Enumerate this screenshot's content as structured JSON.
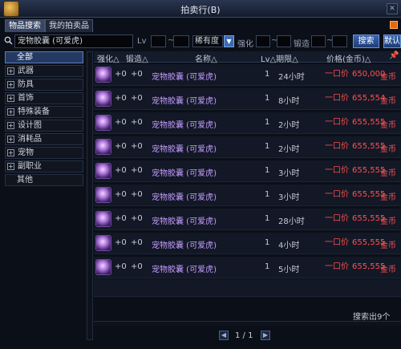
{
  "window": {
    "title": "拍卖行(B)"
  },
  "tabs": [
    {
      "label": "物品搜索"
    },
    {
      "label": "我的拍卖品"
    }
  ],
  "search": {
    "keyword": "宠物胶囊 (可爱虎)",
    "lv_label": "Lv",
    "rarity_value": "稀有度",
    "strength_label": "强化",
    "forge_label": "锻造",
    "tilde": "~",
    "search_button": "搜索",
    "default_button": "默认"
  },
  "categories": [
    {
      "label": "全部",
      "has_expand": false
    },
    {
      "label": "武器",
      "has_expand": true
    },
    {
      "label": "防具",
      "has_expand": true
    },
    {
      "label": "首饰",
      "has_expand": true
    },
    {
      "label": "特殊装备",
      "has_expand": true
    },
    {
      "label": "设计图",
      "has_expand": true
    },
    {
      "label": "消耗品",
      "has_expand": true
    },
    {
      "label": "宠物",
      "has_expand": true
    },
    {
      "label": "副职业",
      "has_expand": true
    },
    {
      "label": "其他",
      "has_expand": false
    }
  ],
  "table": {
    "headers": {
      "strength": "强化△",
      "forge": "锻造△",
      "name": "名称△",
      "lv_time": "Lv△期限△",
      "price": "价格(金币)△"
    },
    "rows": [
      {
        "strength": "+0",
        "forge": "+0",
        "name": "宠物胶囊 (可爱虎)",
        "lv": "1",
        "time": "24小时",
        "buy": "一口价",
        "price": "650,000",
        "unit": "金币"
      },
      {
        "strength": "+0",
        "forge": "+0",
        "name": "宠物胶囊 (可爱虎)",
        "lv": "1",
        "time": "8小时",
        "buy": "一口价",
        "price": "655,554",
        "unit": "金币"
      },
      {
        "strength": "+0",
        "forge": "+0",
        "name": "宠物胶囊 (可爱虎)",
        "lv": "1",
        "time": "2小时",
        "buy": "一口价",
        "price": "655,555",
        "unit": "金币"
      },
      {
        "strength": "+0",
        "forge": "+0",
        "name": "宠物胶囊 (可爱虎)",
        "lv": "1",
        "time": "2小时",
        "buy": "一口价",
        "price": "655,555",
        "unit": "金币"
      },
      {
        "strength": "+0",
        "forge": "+0",
        "name": "宠物胶囊 (可爱虎)",
        "lv": "1",
        "time": "3小时",
        "buy": "一口价",
        "price": "655,555",
        "unit": "金币"
      },
      {
        "strength": "+0",
        "forge": "+0",
        "name": "宠物胶囊 (可爱虎)",
        "lv": "1",
        "time": "3小时",
        "buy": "一口价",
        "price": "655,555",
        "unit": "金币"
      },
      {
        "strength": "+0",
        "forge": "+0",
        "name": "宠物胶囊 (可爱虎)",
        "lv": "1",
        "time": "28小时",
        "buy": "一口价",
        "price": "655,555",
        "unit": "金币"
      },
      {
        "strength": "+0",
        "forge": "+0",
        "name": "宠物胶囊 (可爱虎)",
        "lv": "1",
        "time": "4小时",
        "buy": "一口价",
        "price": "655,555",
        "unit": "金币"
      },
      {
        "strength": "+0",
        "forge": "+0",
        "name": "宠物胶囊 (可爱虎)",
        "lv": "1",
        "time": "5小时",
        "buy": "一口价",
        "price": "655,555",
        "unit": "金币"
      }
    ]
  },
  "pagination": {
    "page_text": "1 / 1"
  },
  "result_count": "搜索出9个",
  "icons": {
    "search": "search-icon",
    "item": "pet-capsule-icon",
    "prev": "arrow-left-icon",
    "next": "arrow-right-icon",
    "pin": "pin-icon",
    "dropdown": "chevron-down-icon"
  },
  "colors": {
    "price": "#ff5050",
    "item_name": "#c59cff",
    "accent": "#3b6ab4"
  }
}
